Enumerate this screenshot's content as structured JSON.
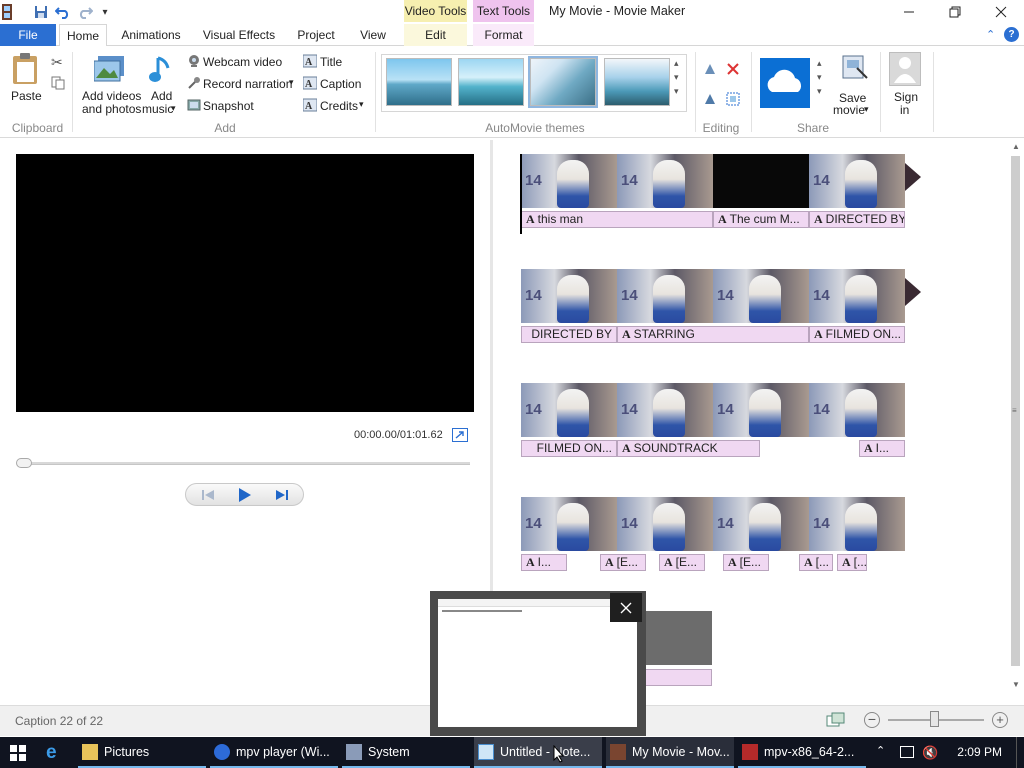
{
  "titlebar": {
    "window_title": "My Movie - Movie Maker",
    "context_tabs": [
      "Video Tools",
      "Text Tools"
    ],
    "qat_icons": [
      "film-icon",
      "save-icon",
      "undo-icon",
      "redo-icon",
      "customize-qat-icon"
    ],
    "controls": [
      "minimize-icon",
      "restore-icon",
      "close-icon"
    ]
  },
  "tabs": [
    {
      "label": "File"
    },
    {
      "label": "Home"
    },
    {
      "label": "Animations"
    },
    {
      "label": "Visual Effects"
    },
    {
      "label": "Project"
    },
    {
      "label": "View"
    },
    {
      "label": "Edit"
    },
    {
      "label": "Format"
    }
  ],
  "ribbon": {
    "clipboard": {
      "paste": "Paste",
      "group": "Clipboard"
    },
    "add": {
      "add_videos_line1": "Add videos",
      "add_videos_line2": "and photos",
      "add_music_line1": "Add",
      "add_music_line2": "music",
      "webcam": "Webcam video",
      "record": "Record narration",
      "snapshot": "Snapshot",
      "title": "Title",
      "caption": "Caption",
      "credits": "Credits",
      "group": "Add"
    },
    "themes": {
      "group": "AutoMovie themes"
    },
    "editing": {
      "group": "Editing"
    },
    "share": {
      "save_line1": "Save",
      "save_line2": "movie",
      "group": "Share"
    },
    "signin": {
      "line1": "Sign",
      "line2": "in"
    }
  },
  "player": {
    "time": "00:00.00/01:01.62"
  },
  "storyboard": {
    "rows": [
      {
        "clips": [
          "thumb",
          "thumb",
          "black",
          "thumb"
        ],
        "captions": [
          "this man",
          "The cum M...",
          "DIRECTED BY"
        ]
      },
      {
        "clips": [
          "thumb",
          "thumb",
          "thumb",
          "thumb"
        ],
        "captions": [
          "DIRECTED BY",
          "STARRING",
          "FILMED ON..."
        ]
      },
      {
        "clips": [
          "thumb",
          "thumb",
          "thumb",
          "thumb"
        ],
        "captions": [
          "FILMED ON...",
          "SOUNDTRACK",
          "I..."
        ]
      },
      {
        "clips": [
          "thumb",
          "thumb",
          "thumb",
          "thumb"
        ],
        "captions": [
          "I...",
          "[E...",
          "[E...",
          "[E...",
          "[...",
          "[..."
        ]
      }
    ]
  },
  "status": {
    "text": "Caption 22 of 22"
  },
  "taskbar": {
    "items": [
      {
        "label": "Pictures"
      },
      {
        "label": "mpv player (Wi..."
      },
      {
        "label": "System"
      },
      {
        "label": "Untitled - Note..."
      },
      {
        "label": "My Movie - Mov..."
      },
      {
        "label": "mpv-x86_64-2..."
      }
    ],
    "clock": "2:09 PM"
  },
  "colors": {
    "file_tab": "#2b6fd2",
    "caption_bg": "#f0d8f2",
    "taskbar": "#101420",
    "video_tools": "#f6efb0",
    "text_tools": "#efc3ee"
  }
}
